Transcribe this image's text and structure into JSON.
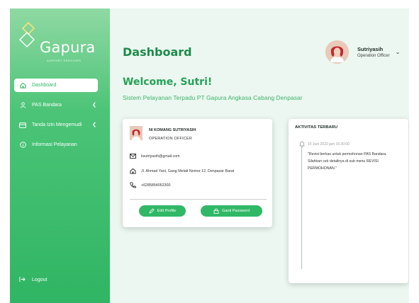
{
  "brand": {
    "name": "Gapura",
    "tagline": "AIRPORT SERVICES",
    "accent": "#2fb563"
  },
  "sidebar": {
    "items": [
      {
        "label": "Dashboard",
        "icon": "home-icon",
        "active": true,
        "has_chevron": false
      },
      {
        "label": "PAS Bandara",
        "icon": "person-icon",
        "active": false,
        "has_chevron": true
      },
      {
        "label": "Tanda Izin Mengemudi",
        "icon": "card-icon",
        "active": false,
        "has_chevron": true
      },
      {
        "label": "Informasi Pelayanan",
        "icon": "info-icon",
        "active": false,
        "has_chevron": false
      }
    ],
    "logout_label": "Logout"
  },
  "header": {
    "title": "Dashboard",
    "user": {
      "name": "Sutriyasih",
      "role": "Operation Officer"
    }
  },
  "welcome": {
    "greeting": "Welcome, Sutri!",
    "subtitle": "Sistem Pelayanan Terpadu PT Gapura Angkasa Cabang Denpasar"
  },
  "profile": {
    "name": "NI KOMANG SUTRIYASIH",
    "position": "OPERATION OFFICER",
    "email": "ksutriyasih@gmail.com",
    "address": "Jl. Ahmad Yani, Gang Melati Nomor 12, Denpasar Barat",
    "phone": "+6285854052300",
    "edit_label": "Edit Profile",
    "password_label": "Ganti Password"
  },
  "activity": {
    "title": "AKTIVITAS TERBARU",
    "items": [
      {
        "date": "15 Juni 2022 jam 15:30:00",
        "text": "\"Revisi berkas untuk permohonan PAS Bandara. Silahkan cek detailnya di sub menu REVISI PERMOHONAN.\""
      }
    ]
  }
}
